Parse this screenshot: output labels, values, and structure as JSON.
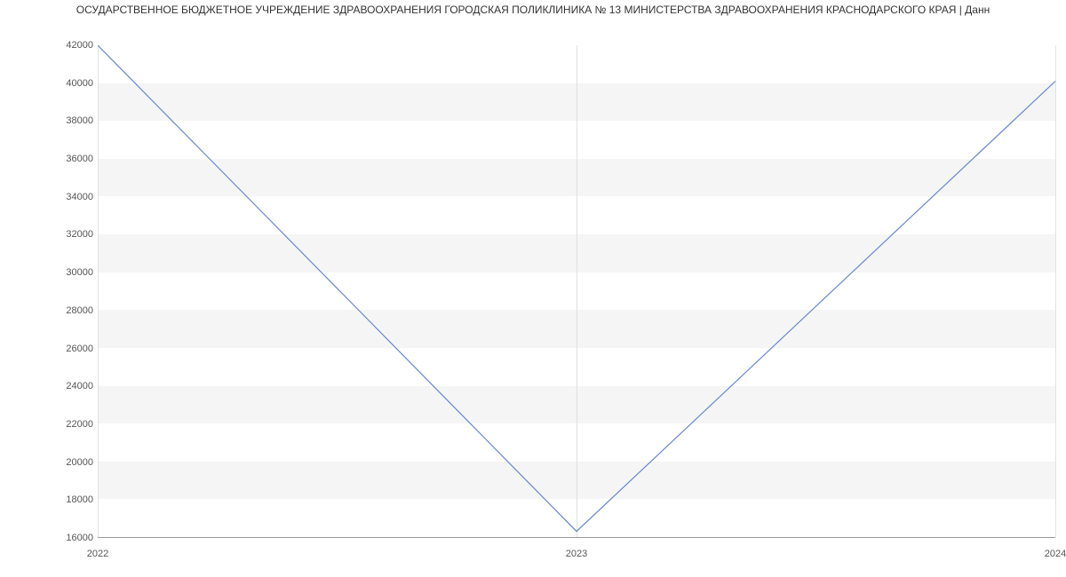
{
  "chart_data": {
    "type": "line",
    "title": "ОСУДАРСТВЕННОЕ БЮДЖЕТНОЕ УЧРЕЖДЕНИЕ ЗДРАВООХРАНЕНИЯ ГОРОДСКАЯ ПОЛИКЛИНИКА № 13 МИНИСТЕРСТВА ЗДРАВООХРАНЕНИЯ КРАСНОДАРСКОГО КРАЯ | Данн",
    "categories": [
      "2022",
      "2023",
      "2024"
    ],
    "values": [
      42000,
      16300,
      40100
    ],
    "xlabel": "",
    "ylabel": "",
    "ylim": [
      16000,
      42000
    ],
    "y_ticks": [
      16000,
      18000,
      20000,
      22000,
      24000,
      26000,
      28000,
      30000,
      32000,
      34000,
      36000,
      38000,
      40000,
      42000
    ],
    "line_color": "#6788d0"
  }
}
